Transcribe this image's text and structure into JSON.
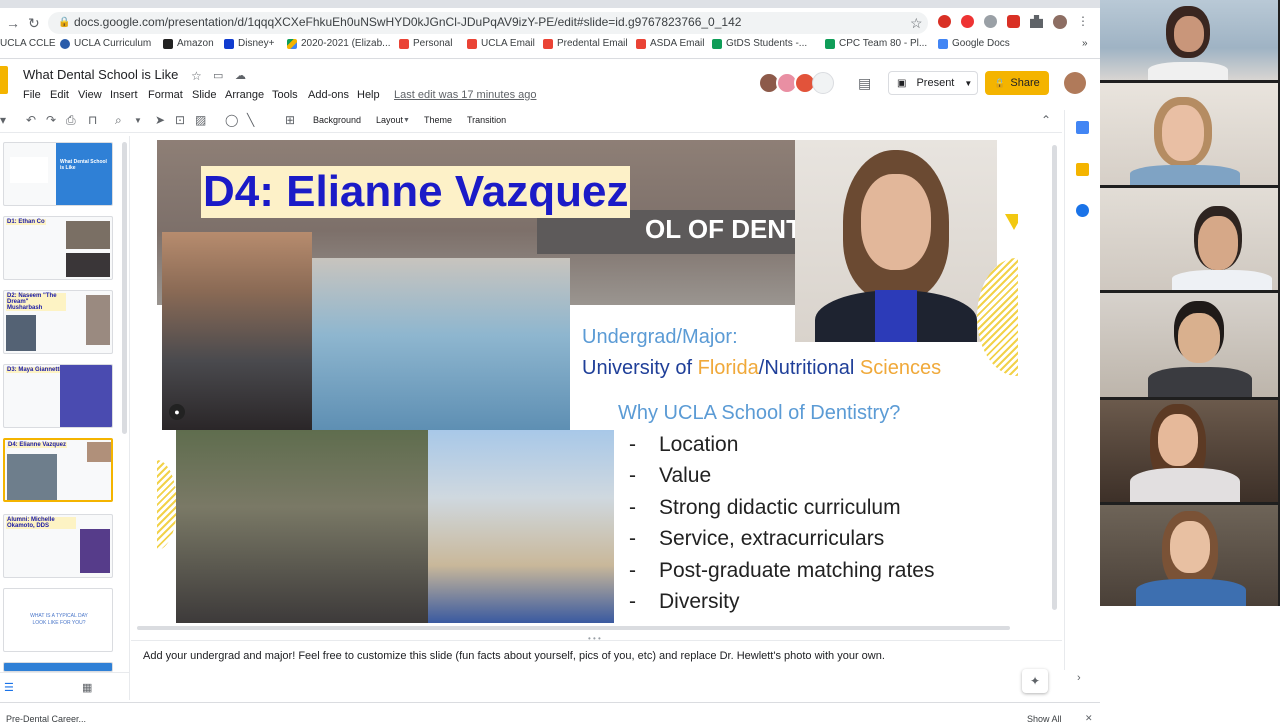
{
  "browser": {
    "url": "docs.google.com/presentation/d/1qqqXCXeFhkuEh0uNSwHYD0kJGnCl-JDuPqAV9izY-PE/edit#slide=id.g9767823766_0_142",
    "bookmarks": [
      "UCLA CCLE",
      "UCLA Curriculum",
      "Amazon",
      "Disney+",
      "2020-2021 (Elizab...",
      "Personal",
      "UCLA Email",
      "Predental Email",
      "ASDA Email",
      "GtDS Students -...",
      "CPC Team 80 - Pl...",
      "Google Docs"
    ],
    "bookmark_more": "»"
  },
  "doc": {
    "title": "What Dental School is Like",
    "menu": [
      "File",
      "Edit",
      "View",
      "Insert",
      "Format",
      "Slide",
      "Arrange",
      "Tools",
      "Add-ons",
      "Help"
    ],
    "last_edit": "Last edit was 17 minutes ago",
    "present_label": "Present",
    "share_label": "Share"
  },
  "toolbar": {
    "background": "Background",
    "layout": "Layout",
    "theme": "Theme",
    "transition": "Transition"
  },
  "filmstrip": [
    {
      "title": "What Dental School is Like"
    },
    {
      "title": "D1: Ethan Co"
    },
    {
      "title": "D2: Naseem \"The Dream\" Musharbash"
    },
    {
      "title": "D3: Maya Giannetti"
    },
    {
      "title": "D4: Elianne Vazquez"
    },
    {
      "title": "Alumni: Michelle Okamoto, DDS"
    },
    {
      "title": "WHAT IS A TYPICAL DAY LOOK LIKE FOR YOU?"
    }
  ],
  "slide": {
    "title": "D4: Elianne Vazquez",
    "undergrad_label": "Undergrad/Major:",
    "school_part1": "University",
    "school_of": "of",
    "school_florida": "Florida",
    "school_slash": "/",
    "school_nutritional": "Nutritional",
    "school_sciences": "Sciences",
    "why_label": "Why UCLA School of Dentistry?",
    "bullets": [
      "Location",
      "Value",
      "Strong didactic curriculum",
      "Service, extracurriculars",
      "Post-graduate matching rates",
      "Diversity"
    ],
    "dash": "-",
    "building_sign": "OL OF DENTISTR"
  },
  "notes": {
    "text": "Add your undergrad and major! Feel free to customize this slide (fun facts about yourself, pics of you, etc) and replace Dr. Hewlett's photo with your own."
  },
  "bottom_bar": {
    "left_text": "Pre-Dental Career...",
    "show_all": "Show All"
  },
  "colors": {
    "title_blue": "#1b1bc7",
    "title_bg": "#fdf1c8",
    "light_blue": "#5b9bd5",
    "navy": "#1f3f99",
    "orange": "#f0a93a",
    "share_yellow": "#f4b400"
  }
}
